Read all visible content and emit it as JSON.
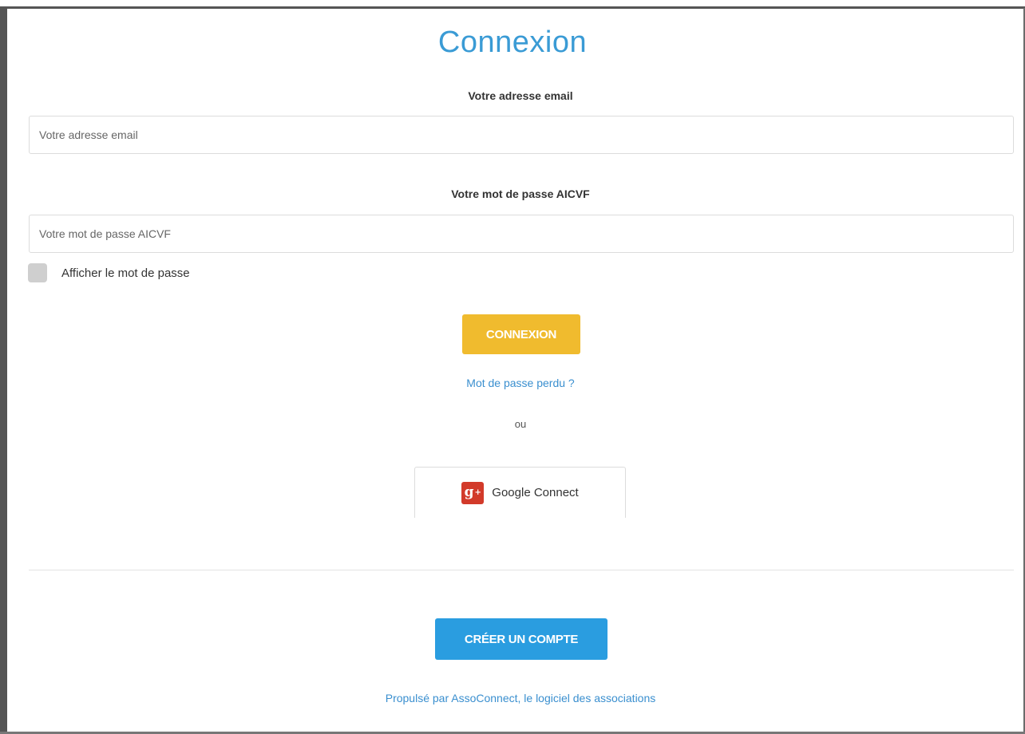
{
  "page": {
    "title": "Connexion"
  },
  "form": {
    "email_label": "Votre adresse email",
    "email_placeholder": "Votre adresse email",
    "email_value": "",
    "password_label": "Votre mot de passe AICVF",
    "password_placeholder": "Votre mot de passe AICVF",
    "password_value": "",
    "show_password_label": "Afficher le mot de passe",
    "show_password_checked": false,
    "submit_label": "CONNEXION",
    "lost_password_link": "Mot de passe perdu ?",
    "or_text": "ou",
    "google_label": "Google Connect",
    "google_icon": "google-plus-icon"
  },
  "footer": {
    "create_account_label": "CRÉER UN COMPTE",
    "powered_by": "Propulsé par AssoConnect, le logiciel des associations"
  },
  "colors": {
    "title": "#3a9bd5",
    "submit_button": "#f0bb2e",
    "create_button": "#2a9de0",
    "link": "#3a8fcf",
    "google_icon_bg": "#d23a2a"
  }
}
